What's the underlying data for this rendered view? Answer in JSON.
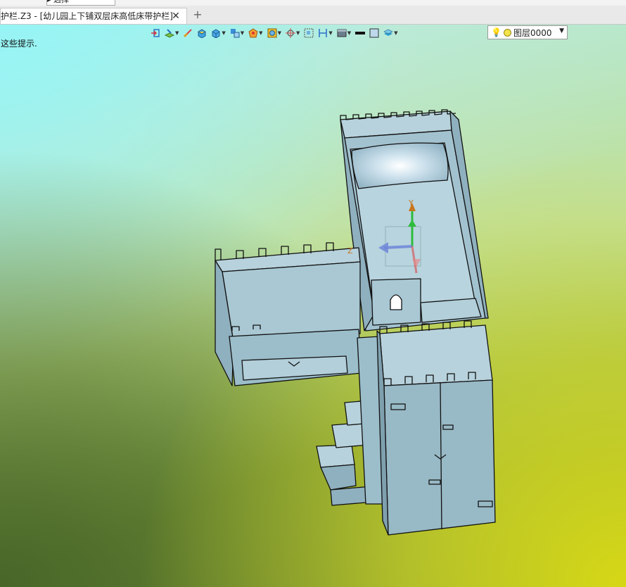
{
  "quick_access": {
    "partial_text": "▸   选择"
  },
  "tab": {
    "title": "护栏.Z3 - [幼儿园上下铺双层床高低床带护栏]",
    "close_glyph": "✕",
    "new_tab_glyph": "+"
  },
  "hint_text": "这些提示.",
  "toolbar": {
    "icons": [
      "exit-icon",
      "sketch-plane-icon",
      "brush-icon",
      "solid-box-icon",
      "box-view-icon",
      "view-cube-icon",
      "render-icon",
      "display-icon",
      "snap-icon",
      "frame-icon",
      "dimension-icon",
      "shade-icon",
      "line-color-icon",
      "fill-color-icon",
      "layer-stack-icon"
    ],
    "layer_select": {
      "value": "图层0000",
      "bulb": "💡"
    }
  },
  "axes": {
    "y_label": "Y",
    "z_label": "Z"
  },
  "colors": {
    "model_fill": "#a9c8d4",
    "model_stroke": "#111111",
    "axis_y": "#2dbb3c",
    "axis_x": "#d65a5a",
    "axis_z": "#6f86d8",
    "layer_dot": "#f2e34a"
  }
}
